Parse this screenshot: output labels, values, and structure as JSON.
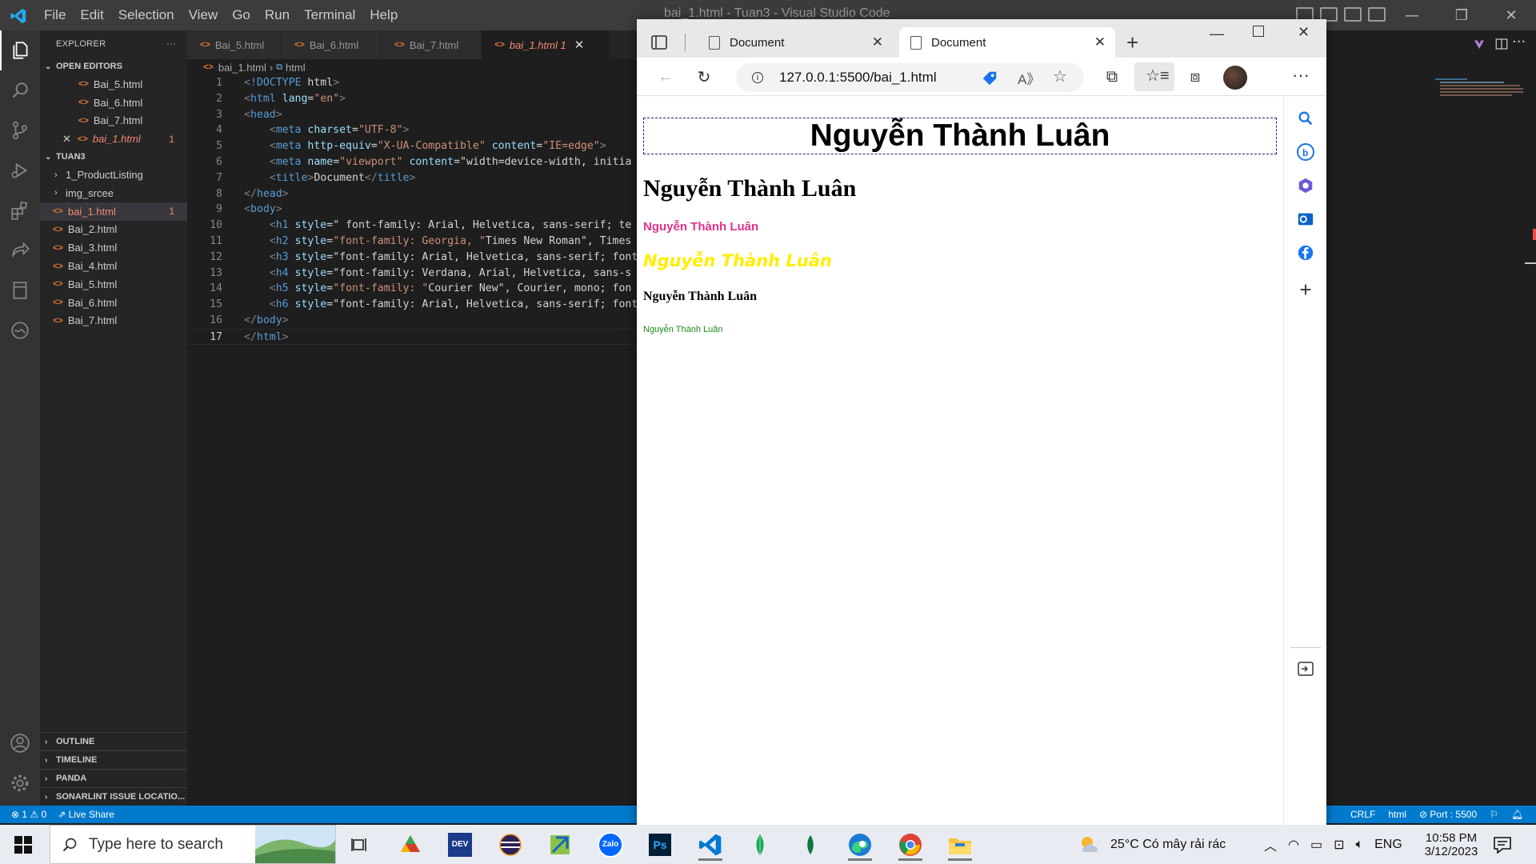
{
  "vscode": {
    "menu": [
      "File",
      "Edit",
      "Selection",
      "View",
      "Go",
      "Run",
      "Terminal",
      "Help"
    ],
    "window_title": "bai_1.html - Tuan3 - Visual Studio Code",
    "explorer_title": "EXPLORER",
    "explorer_more": "···",
    "open_editors_label": "OPEN EDITORS",
    "open_editors": [
      "Bai_5.html",
      "Bai_6.html",
      "Bai_7.html",
      "bai_1.html"
    ],
    "open_editor_badge": "1",
    "workspace_label": "TUAN3",
    "tree": [
      {
        "name": "1_ProductListing",
        "folder": true
      },
      {
        "name": "img_srcee",
        "folder": true
      },
      {
        "name": "bai_1.html",
        "badge": "1"
      },
      {
        "name": "Bai_2.html"
      },
      {
        "name": "Bai_3.html"
      },
      {
        "name": "Bai_4.html"
      },
      {
        "name": "Bai_5.html"
      },
      {
        "name": "Bai_6.html"
      },
      {
        "name": "Bai_7.html"
      }
    ],
    "bottom_sections": [
      "OUTLINE",
      "TIMELINE",
      "PANDA",
      "SONARLINT ISSUE LOCATIO..."
    ],
    "tabs": [
      "Bai_5.html",
      "Bai_6.html",
      "Bai_7.html",
      "bai_1.html 1"
    ],
    "breadcrumb": {
      "file": "bai_1.html",
      "node": "html"
    },
    "code_lines": [
      "<!DOCTYPE html>",
      "<html lang=\"en\">",
      "<head>",
      "    <meta charset=\"UTF-8\">",
      "    <meta http-equiv=\"X-UA-Compatible\" content=\"IE=edge\">",
      "    <meta name=\"viewport\" content=\"width=device-width, initia",
      "    <title>Document</title>",
      "</head>",
      "<body>",
      "    <h1 style=\" font-family: Arial, Helvetica, sans-serif; te",
      "    <h2 style=\"font-family: Georgia, \"Times New Roman\", Times",
      "    <h3 style=\"font-family: Arial, Helvetica, sans-serif; font",
      "    <h4 style=\"font-family: Verdana, Arial, Helvetica, sans-s",
      "    <h5 style=\"font-family: \"Courier New\", Courier, mono; fon",
      "    <h6 style=\"font-family: Arial, Helvetica, sans-serif; font",
      "</body>",
      "</html>"
    ],
    "current_line": 17,
    "status_left": {
      "errors": "1",
      "warnings": "0",
      "live_share": "Live Share"
    },
    "status_right": {
      "eol": "CRLF",
      "lang": "html",
      "port": "Port : 5500"
    }
  },
  "edge": {
    "tabs": [
      {
        "title": "Document",
        "active": false
      },
      {
        "title": "Document",
        "active": true
      }
    ],
    "url": "127.0.0.1:5500/bai_1.html",
    "page": {
      "h1": "Nguyễn Thành Luân",
      "h2": "Nguyễn Thành Luân",
      "h3": "Nguyễn Thành Luân",
      "h4": "Nguyễn Thành Luân",
      "h5": "Nguyễn Thành Luân",
      "h6": "Nguyễn Thành Luân"
    },
    "colors": {
      "h3": "#e0338a",
      "h4": "#ffee00",
      "h6": "#1a8a1a",
      "border": "#1a1a8c"
    }
  },
  "taskbar": {
    "search_placeholder": "Type here to search",
    "apps": [
      "task-view-icon",
      "app-icon",
      "devc-icon",
      "eclipse-icon",
      "app-icon",
      "zalo-icon",
      "photoshop-icon",
      "vscode-icon",
      "mongodb-icon",
      "mongodb-compass-icon",
      "edge-icon",
      "chrome-icon",
      "file-explorer-icon"
    ],
    "zalo_label": "Zalo",
    "ps_label": "Ps",
    "dev_label": "DEV",
    "weather": "25°C  Có mây rải rác",
    "lang": "ENG",
    "time": "10:58 PM",
    "date": "3/12/2023"
  }
}
